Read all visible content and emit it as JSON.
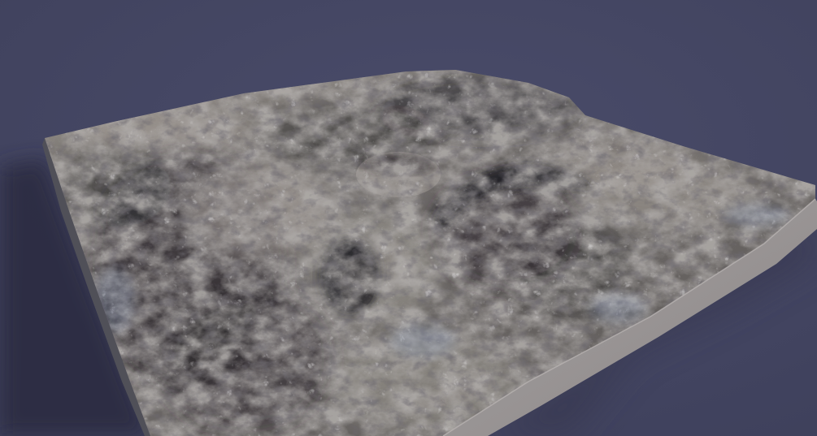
{
  "scene": {
    "subject": "terrain-block",
    "background_color": "#3d3f5a",
    "background_highlight_color": "#4a4c6a",
    "terrain_base_color": "#6e6a68",
    "terrain_light_color": "#a9a39c",
    "terrain_dark_color": "#2c2a2d",
    "side_face_color": "#a5a0a0",
    "side_face_shadow_color": "#8c8888",
    "cast_shadow_color": "#2b2c40"
  }
}
